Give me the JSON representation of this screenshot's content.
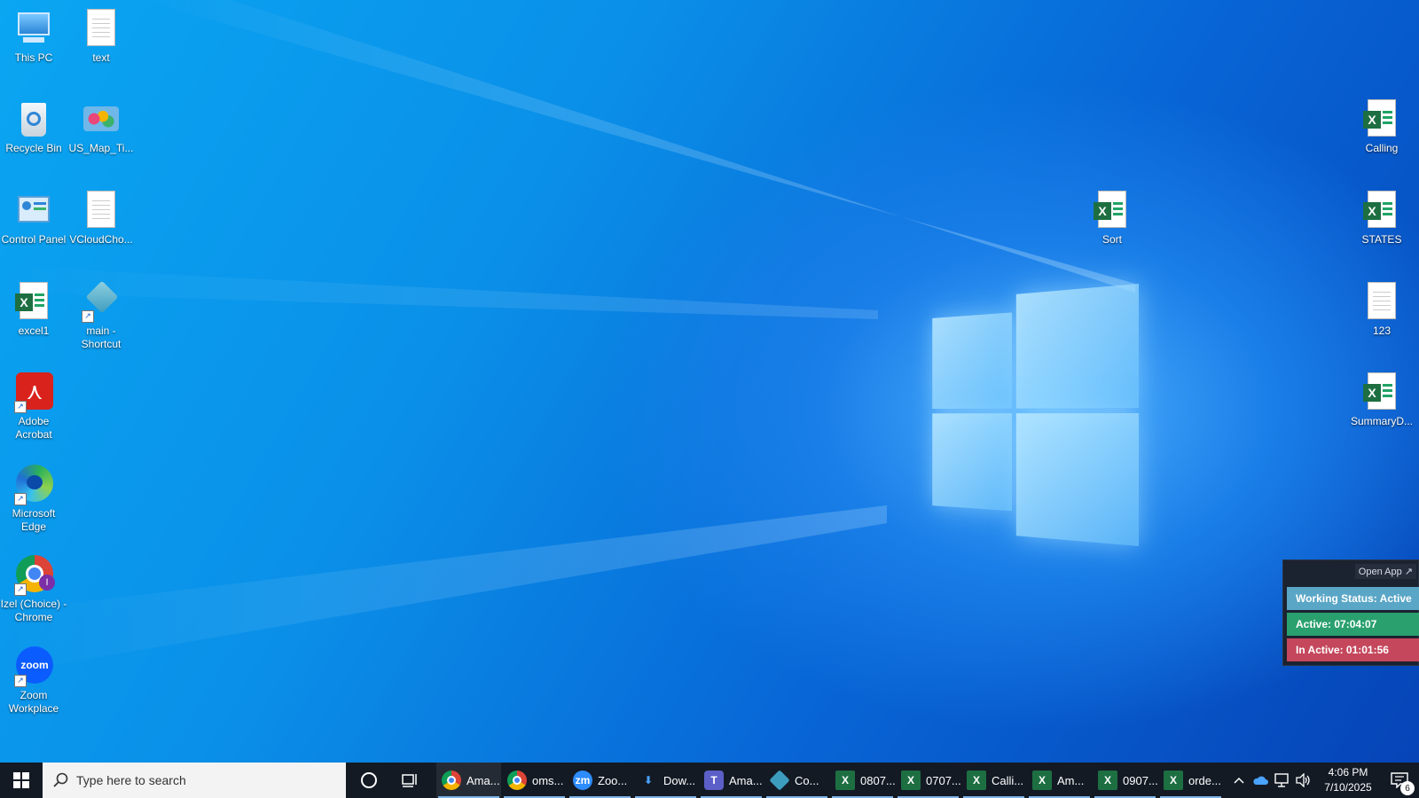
{
  "desktop": {
    "icons_left": [
      {
        "label": "This PC",
        "icon": "computer-icon"
      },
      {
        "label": "text",
        "icon": "text-file-icon"
      },
      {
        "label": "Recycle Bin",
        "icon": "recycle-bin-icon"
      },
      {
        "label": "US_Map_Ti...",
        "icon": "image-file-icon"
      },
      {
        "label": "Control Panel",
        "icon": "control-panel-icon"
      },
      {
        "label": "VCloudCho...",
        "icon": "text-file-icon"
      },
      {
        "label": "excel1",
        "icon": "excel-file-icon"
      },
      {
        "label": "main - Shortcut",
        "icon": "app-shortcut-icon"
      },
      {
        "label": "Adobe Acrobat",
        "icon": "adobe-acrobat-icon"
      },
      {
        "label": "Microsoft Edge",
        "icon": "edge-icon"
      },
      {
        "label": "Izel (Choice) - Chrome",
        "icon": "chrome-icon"
      },
      {
        "label": "Zoom Workplace",
        "icon": "zoom-icon"
      }
    ],
    "icons_right": [
      {
        "label": "Calling",
        "icon": "excel-file-icon"
      },
      {
        "label": "Sort",
        "icon": "excel-file-icon"
      },
      {
        "label": "STATES",
        "icon": "excel-file-icon"
      },
      {
        "label": "123",
        "icon": "text-file-icon"
      },
      {
        "label": "SummaryD...",
        "icon": "excel-file-icon"
      }
    ],
    "zoom_logo_text": "zoom",
    "excel_letter": "X"
  },
  "status_widget": {
    "open_app": "Open App ↗",
    "working_status": "Working Status: Active",
    "active": "Active: 07:04:07",
    "inactive": "In Active: 01:01:56",
    "colors": {
      "working": "#5aa6c6",
      "active": "#2aa06e",
      "inactive": "#c4475c"
    }
  },
  "taskbar": {
    "search_placeholder": "Type here to search",
    "tasks": [
      {
        "label": "Ama...",
        "icon": "chrome-icon"
      },
      {
        "label": "oms...",
        "icon": "chrome-icon"
      },
      {
        "label": "Zoo...",
        "icon": "zoom-icon",
        "glyph": "zm"
      },
      {
        "label": "Dow...",
        "icon": "download-icon",
        "glyph": "⬇"
      },
      {
        "label": "Ama...",
        "icon": "teams-icon",
        "glyph": "T"
      },
      {
        "label": "Co...",
        "icon": "app-icon"
      },
      {
        "label": "0807...",
        "icon": "excel-icon",
        "glyph": "X"
      },
      {
        "label": "0707...",
        "icon": "excel-icon",
        "glyph": "X"
      },
      {
        "label": "Calli...",
        "icon": "excel-icon",
        "glyph": "X"
      },
      {
        "label": "Am...",
        "icon": "excel-icon",
        "glyph": "X"
      },
      {
        "label": "0907...",
        "icon": "excel-icon",
        "glyph": "X"
      },
      {
        "label": "orde...",
        "icon": "excel-icon",
        "glyph": "X"
      }
    ],
    "clock_time": "4:06 PM",
    "clock_date": "7/10/2025",
    "notification_count": "6"
  }
}
